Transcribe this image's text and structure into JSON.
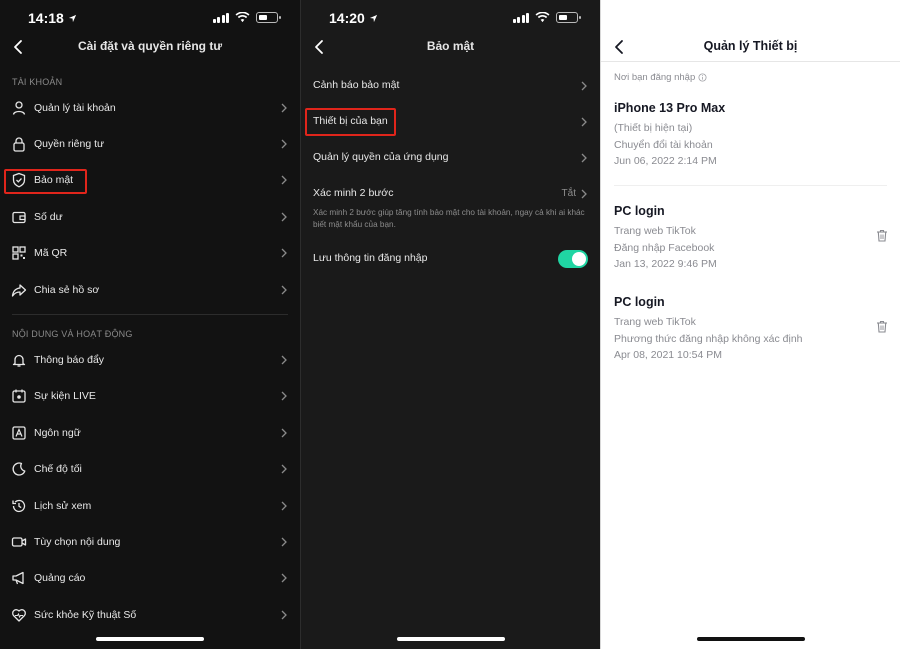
{
  "screens": [
    {
      "status_time": "14:18",
      "title": "Cài đặt và quyền riêng tư",
      "section_account": "TÀI KHOẢN",
      "account_items": [
        {
          "label": "Quản lý tài khoản",
          "icon": "person-icon"
        },
        {
          "label": "Quyền riêng tư",
          "icon": "lock-icon"
        },
        {
          "label": "Bảo mật",
          "icon": "shield-icon"
        },
        {
          "label": "Số dư",
          "icon": "wallet-icon"
        },
        {
          "label": "Mã QR",
          "icon": "qr-code-icon"
        },
        {
          "label": "Chia sẻ hồ sơ",
          "icon": "share-icon"
        }
      ],
      "section_content": "NỘI DUNG VÀ HOẠT ĐỘNG",
      "content_items": [
        {
          "label": "Thông báo đẩy",
          "icon": "bell-icon"
        },
        {
          "label": "Sự kiện LIVE",
          "icon": "calendar-icon"
        },
        {
          "label": "Ngôn ngữ",
          "icon": "language-icon"
        },
        {
          "label": "Chế độ tối",
          "icon": "moon-icon"
        },
        {
          "label": "Lịch sử xem",
          "icon": "history-icon"
        },
        {
          "label": "Tùy chọn nội dung",
          "icon": "video-icon"
        },
        {
          "label": "Quảng cáo",
          "icon": "megaphone-icon"
        },
        {
          "label": "Sức khỏe Kỹ thuật Số",
          "icon": "heart-icon"
        }
      ]
    },
    {
      "status_time": "14:20",
      "title": "Bảo mật",
      "items": [
        {
          "label": "Cảnh báo bảo mật"
        },
        {
          "label": "Thiết bị của bạn"
        },
        {
          "label": "Quản lý quyền của ứng dụng"
        }
      ],
      "two_step": {
        "label": "Xác minh 2 bước",
        "value": "Tắt",
        "description": "Xác minh 2 bước giúp tăng tính bảo mật cho tài khoản, ngay cả khi ai khác biết mật khẩu của bạn."
      },
      "save_login": {
        "label": "Lưu thông tin đăng nhập",
        "enabled": true
      }
    },
    {
      "title": "Quản lý Thiết bị",
      "subheading": "Nơi bạn đăng nhập",
      "devices": [
        {
          "name": "iPhone 13 Pro Max",
          "line1": "(Thiết bị hiện tại)",
          "line2": "Chuyển đổi tài khoản",
          "line3": "Jun 06, 2022 2:14 PM"
        },
        {
          "name": "PC login",
          "line1": "Trang web TikTok",
          "line2": "Đăng nhập Facebook",
          "line3": "Jan 13, 2022 9:46 PM"
        },
        {
          "name": "PC login",
          "line1": "Trang web TikTok",
          "line2": "Phương thức đăng nhập không xác định",
          "line3": "Apr 08, 2021 10:54 PM"
        }
      ]
    }
  ],
  "colors": {
    "highlight": "#e0251b",
    "toggle_on": "#20d5a3"
  }
}
